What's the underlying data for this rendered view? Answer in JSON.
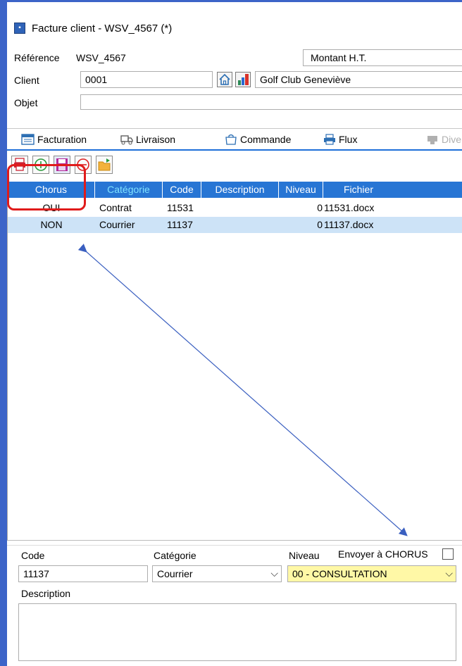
{
  "window": {
    "title": "Facture client - WSV_4567 (*)"
  },
  "form": {
    "reference_label": "Référence",
    "reference_value": "WSV_4567",
    "montant_label": "Montant H.T.",
    "client_label": "Client",
    "client_code": "0001",
    "client_name": "Golf Club Geneviève",
    "objet_label": "Objet",
    "objet_value": ""
  },
  "tabs": [
    {
      "label": "Facturation",
      "icon": "invoice-icon"
    },
    {
      "label": "Livraison",
      "icon": "truck-icon"
    },
    {
      "label": "Commande",
      "icon": "bag-icon"
    },
    {
      "label": "Flux",
      "icon": "printer-icon"
    },
    {
      "label": "Dive",
      "icon": "misc-icon"
    }
  ],
  "grid": {
    "columns": [
      "Chorus",
      "Catégorie",
      "Code",
      "Description",
      "Niveau",
      "Fichier"
    ],
    "rows": [
      {
        "chorus": "OUI",
        "categorie": "Contrat",
        "code": "11531",
        "description": "",
        "niveau": "0",
        "fichier": "11531.docx"
      },
      {
        "chorus": "NON",
        "categorie": "Courrier",
        "code": "11137",
        "description": "",
        "niveau": "0",
        "fichier": "11137.docx"
      }
    ]
  },
  "detail": {
    "code_label": "Code",
    "code_value": "11137",
    "categorie_label": "Catégorie",
    "categorie_value": "Courrier",
    "niveau_label": "Niveau",
    "niveau_value": "00 - CONSULTATION",
    "chorus_label": "Envoyer à CHORUS",
    "chorus_checked": false,
    "description_label": "Description",
    "description_value": ""
  },
  "colors": {
    "accent": "#2775d4",
    "highlight_box": "#e01b1b",
    "niveau_bg": "#fff8a6",
    "selected_row": "#cde3f7"
  }
}
